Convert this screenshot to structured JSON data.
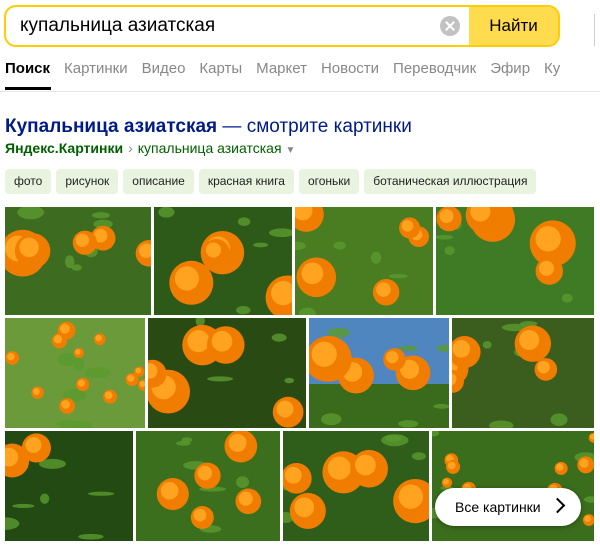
{
  "search": {
    "query": "купальница азиатская",
    "clear_icon": "close-circle-icon",
    "find_label": "Найти"
  },
  "nav": {
    "tabs": [
      "Поиск",
      "Картинки",
      "Видео",
      "Карты",
      "Маркет",
      "Новости",
      "Переводчик",
      "Эфир",
      "Ку"
    ],
    "active_tab": "Поиск"
  },
  "result": {
    "title_bold": "Купальница азиатская",
    "title_rest": " — смотрите картинки",
    "site": "Яндекс.Картинки",
    "separator": "›",
    "path": "купальница азиатская",
    "path_icon": "triangle-down-icon"
  },
  "tags": [
    "фото",
    "рисунок",
    "описание",
    "красная книга",
    "огоньки",
    "ботаническая иллюстрация"
  ],
  "images": {
    "accent_orange": "#f07d00",
    "accent_green": "#2f6e1f",
    "all_images_label": "Все картинки",
    "all_images_icon": "chevron-right-icon"
  }
}
